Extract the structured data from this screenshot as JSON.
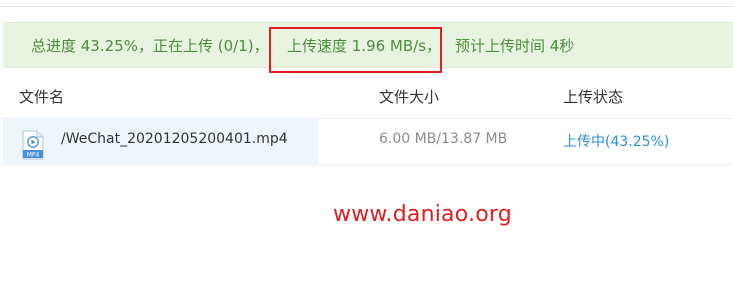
{
  "progress_banner": {
    "total_progress": "总进度 43.25%，正在上传 (0/1)，",
    "upload_speed": "上传速度 1.96 MB/s，",
    "eta": "预计上传时间 4秒"
  },
  "table": {
    "headers": {
      "name": "文件名",
      "size": "文件大小",
      "status": "上传状态"
    },
    "rows": [
      {
        "icon": "mp4-file-icon",
        "icon_label": "MP4",
        "name": "/WeChat_20201205200401.mp4",
        "size": "6.00 MB/13.87 MB",
        "status": "上传中(43.25%)"
      }
    ]
  },
  "watermark": "www.daniao.org",
  "colors": {
    "banner_bg": "#e9f3e2",
    "banner_text": "#4a8f3a",
    "highlight_box": "#e01f1f",
    "status_text": "#2c8fd6",
    "selected_row_bg": "#eef6fc"
  }
}
